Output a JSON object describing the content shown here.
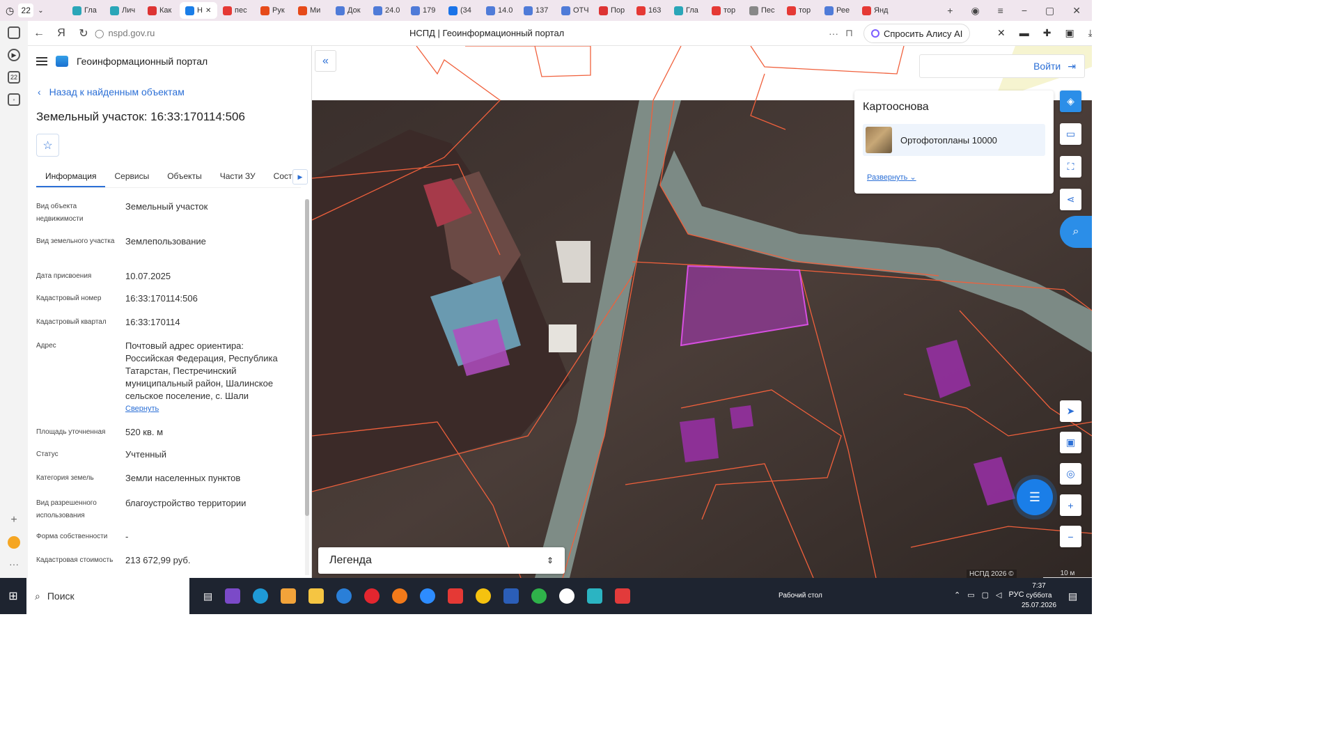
{
  "browser": {
    "tab_count": "22",
    "tabs": [
      {
        "label": "Гла",
        "color": "#2aa6b8"
      },
      {
        "label": "Лич",
        "color": "#2aa6b8"
      },
      {
        "label": "Как",
        "color": "#d33"
      },
      {
        "label": "Н",
        "color": "#1a7ee8",
        "active": true
      },
      {
        "label": "пес",
        "color": "#e53935"
      },
      {
        "label": "Рук",
        "color": "#e64a19"
      },
      {
        "label": "Ми",
        "color": "#e64a19"
      },
      {
        "label": "Док",
        "color": "#4f7bd8"
      },
      {
        "label": "24.0",
        "color": "#4f7bd8"
      },
      {
        "label": "179",
        "color": "#4f7bd8"
      },
      {
        "label": "(34",
        "color": "#1a73e8"
      },
      {
        "label": "14.0",
        "color": "#4f7bd8"
      },
      {
        "label": "137",
        "color": "#4f7bd8"
      },
      {
        "label": "ОТЧ",
        "color": "#4f7bd8"
      },
      {
        "label": "Пор",
        "color": "#d33"
      },
      {
        "label": "163",
        "color": "#e53935"
      },
      {
        "label": "Гла",
        "color": "#2aa6b8"
      },
      {
        "label": "тор",
        "color": "#e53935"
      },
      {
        "label": "Пес",
        "color": "#888"
      },
      {
        "label": "тор",
        "color": "#e53935"
      },
      {
        "label": "Рее",
        "color": "#4f7bd8"
      },
      {
        "label": "Янд",
        "color": "#e53935"
      }
    ],
    "url": "nspd.gov.ru",
    "page_title": "НСПД | Геоинформационный портал",
    "alice_label": "Спросить Алису AI"
  },
  "panel": {
    "portal_name": "Геоинформационный портал",
    "back_label": "Назад к найденным объектам",
    "object_title": "Земельный участок: 16:33:170114:506",
    "tabs": [
      "Информация",
      "Сервисы",
      "Объекты",
      "Части ЗУ",
      "Состав"
    ],
    "properties": [
      {
        "label": "Вид объекта недвижимости",
        "value": "Земельный участок"
      },
      {
        "label": "Вид земельного участка",
        "value": "Землепользование"
      },
      {
        "label": "Дата присвоения",
        "value": "10.07.2025"
      },
      {
        "label": "Кадастровый номер",
        "value": "16:33:170114:506"
      },
      {
        "label": "Кадастровый квартал",
        "value": "16:33:170114"
      },
      {
        "label": "Адрес",
        "value": "Почтовый адрес ориентира: Российская Федерация, Республика Татарстан, Пестречинский муниципальный район, Шалинское сельское поселение, с. Шали"
      },
      {
        "label": "Площадь уточненная",
        "value": "520 кв. м"
      },
      {
        "label": "Статус",
        "value": "Учтенный"
      },
      {
        "label": "Категория земель",
        "value": "Земли населенных пунктов"
      },
      {
        "label": "Вид разрешенного использования",
        "value": "благоустройство территории"
      },
      {
        "label": "Форма собственности",
        "value": "-"
      },
      {
        "label": "Кадастровая стоимость",
        "value": "213 672,99 руб."
      }
    ],
    "collapse_label": "Свернуть"
  },
  "map": {
    "login_label": "Войти",
    "basemap_title": "Картооснова",
    "basemap_item": "Ортофотопланы 10000",
    "expand_label": "Развернуть",
    "legend_label": "Легенда",
    "copyright": "НСПД 2026 ©",
    "scale_label": "10 м"
  },
  "taskbar": {
    "search_label": "Поиск",
    "desktop_label": "Рабочий стол",
    "lang": "РУС",
    "time": "7:37",
    "weekday": "суббота",
    "date": "25.07.2026"
  }
}
